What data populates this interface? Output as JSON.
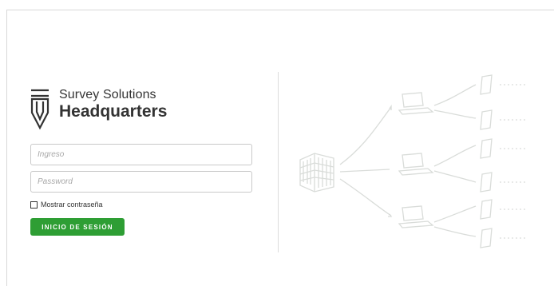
{
  "brand": {
    "subtitle": "Survey Solutions",
    "title": "Headquarters"
  },
  "login_form": {
    "login_placeholder": "Ingreso",
    "password_placeholder": "Password",
    "show_password_label": "Mostrar contraseña",
    "show_password_checked": false,
    "signin_label": "INICIO DE SESIÓN"
  },
  "colors": {
    "accent": "#2e9e34",
    "text": "#333333",
    "illustration": "#d9dcd9"
  },
  "illustration": {
    "icons": [
      "building-icon",
      "laptop-icon",
      "tablet-icon"
    ]
  }
}
